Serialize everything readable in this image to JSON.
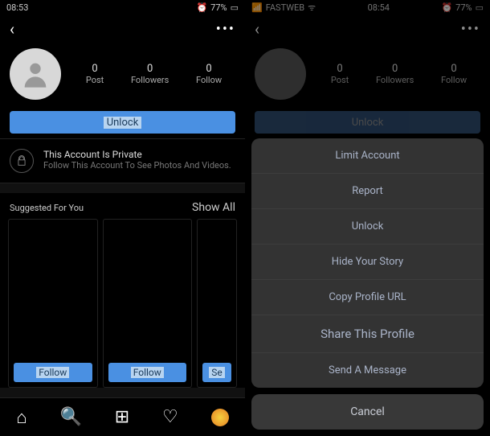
{
  "left": {
    "status": {
      "time": "08:53",
      "battery": "77%"
    },
    "stats": {
      "post_num": "0",
      "post_label": "Post",
      "followers_num": "0",
      "followers_label": "Followers",
      "follow_num": "0",
      "follow_label": "Follow"
    },
    "unlock_label": "Unlock",
    "private": {
      "title": "This Account Is Private",
      "sub": "Follow This Account To See Photos And Videos."
    },
    "suggested": {
      "title": "Suggested For You",
      "show_all": "Show All"
    },
    "cards": {
      "follow1": "Follow",
      "follow2": "Follow",
      "follow3": "Se"
    }
  },
  "right": {
    "status": {
      "carrier": "FASTWEB",
      "time": "08:54",
      "battery": "77%"
    },
    "stats": {
      "post_num": "0",
      "post_label": "Post",
      "followers_num": "0",
      "followers_label": "Followers",
      "follow_num": "0",
      "follow_label": "Follow"
    },
    "unlock_label": "Unlock",
    "sheet": {
      "limit": "Limit Account",
      "report": "Report",
      "unlock": "Unlock",
      "hide": "Hide Your Story",
      "copy": "Copy Profile URL",
      "share": "Share This Profile",
      "message": "Send A Message",
      "cancel": "Cancel"
    }
  }
}
